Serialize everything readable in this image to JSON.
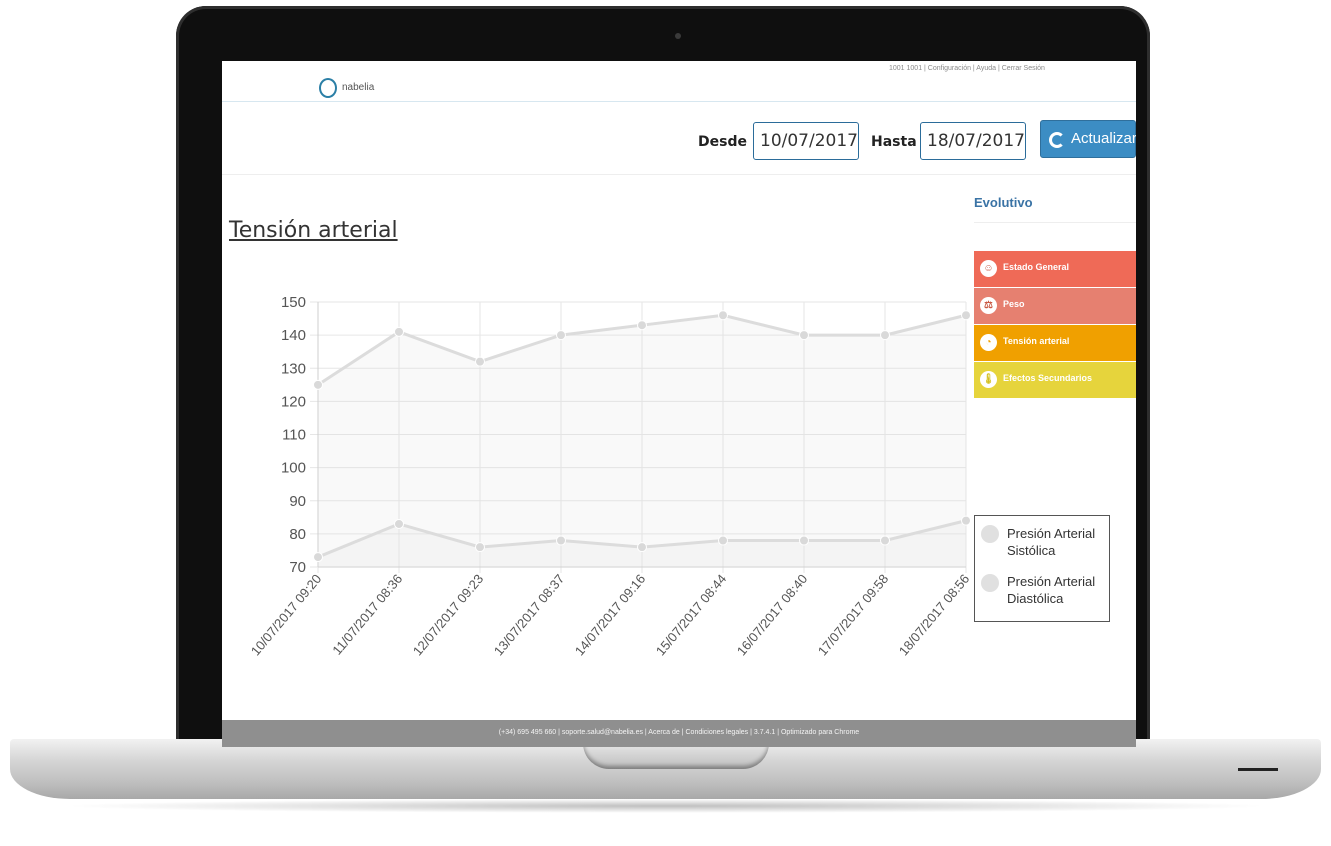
{
  "header": {
    "logo_text": "nabelia",
    "top_links": "1001 1001 | Configuración | Ayuda | Cerrar Sesión"
  },
  "filter": {
    "from_label": "Desde",
    "from_value": "10/07/2017",
    "to_label": "Hasta",
    "to_value": "18/07/2017",
    "update_label": "Actualizar"
  },
  "main": {
    "title": "Tensión arterial"
  },
  "sidebar": {
    "title": "Evolutivo",
    "items": [
      {
        "label": "Estado General",
        "icon": "smiley-icon",
        "color": "#ef6a57"
      },
      {
        "label": "Peso",
        "icon": "scale-icon",
        "color": "#e68070"
      },
      {
        "label": "Tensión arterial",
        "icon": "pressure-gauge-icon",
        "color": "#f0a000"
      },
      {
        "label": "Efectos Secundarios",
        "icon": "thermometer-icon",
        "color": "#e6d43c"
      }
    ]
  },
  "chart_data": {
    "type": "line",
    "title": "",
    "xlabel": "",
    "ylabel": "",
    "ylim": [
      70,
      150
    ],
    "yticks": [
      70,
      80,
      90,
      100,
      110,
      120,
      130,
      140,
      150
    ],
    "grid": true,
    "legend_position": "right",
    "x": [
      "10/07/2017 09:20",
      "11/07/2017 08:36",
      "12/07/2017 09:23",
      "13/07/2017 08:37",
      "14/07/2017 09:16",
      "15/07/2017 08:44",
      "16/07/2017 08:40",
      "17/07/2017 09:58",
      "18/07/2017 08:56"
    ],
    "series": [
      {
        "name": "Presión Arterial Sistólica",
        "values": [
          125,
          141,
          132,
          140,
          143,
          146,
          140,
          140,
          146
        ]
      },
      {
        "name": "Presión Arterial Diastólica",
        "values": [
          73,
          83,
          76,
          78,
          76,
          78,
          78,
          78,
          84
        ]
      }
    ]
  },
  "footer": {
    "text": "(+34) 695 495 660 | soporte.salud@nabelia.es | Acerca de | Condiciones legales | 3.7.4.1 | Optimizado para Chrome"
  }
}
